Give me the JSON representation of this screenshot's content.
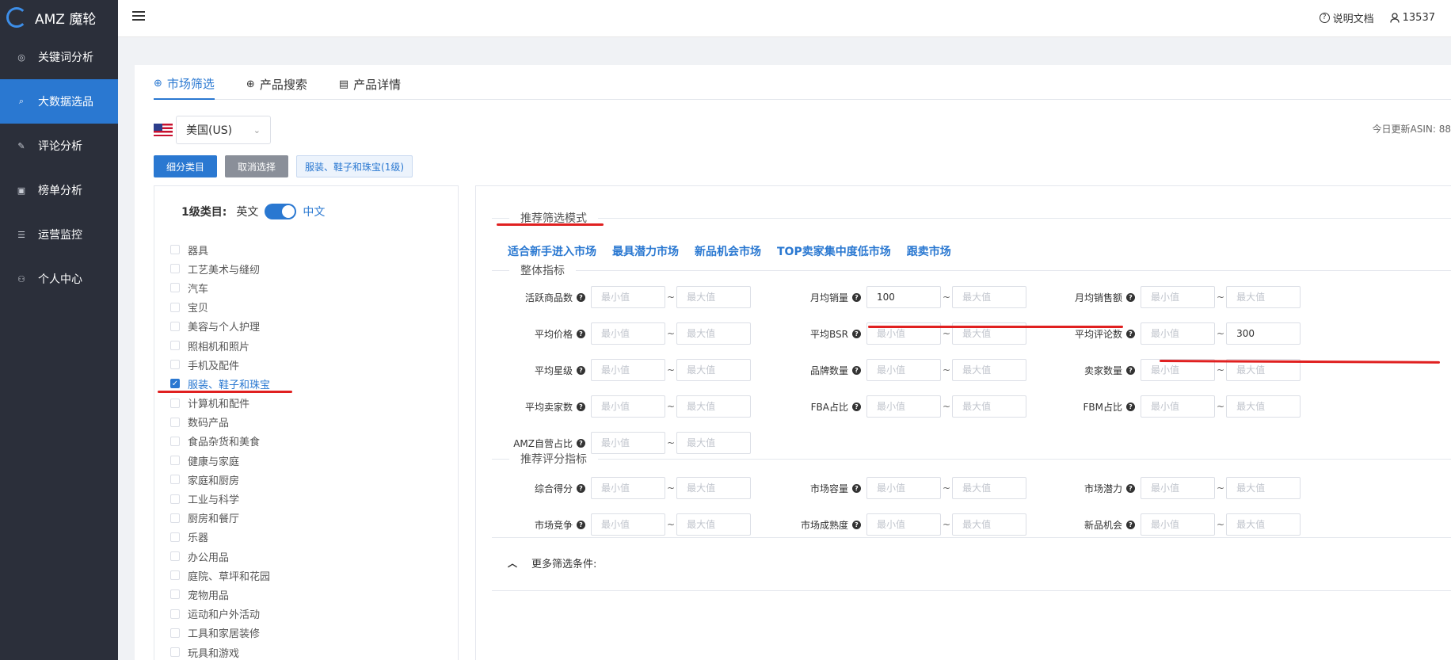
{
  "app": {
    "name": "AMZ 魔轮"
  },
  "sidebar": {
    "items": [
      {
        "label": "关键词分析",
        "icon": "target-icon"
      },
      {
        "label": "大数据选品",
        "icon": "search-icon",
        "active": true
      },
      {
        "label": "评论分析",
        "icon": "edit-icon"
      },
      {
        "label": "榜单分析",
        "icon": "calendar-icon"
      },
      {
        "label": "运营监控",
        "icon": "list-icon"
      },
      {
        "label": "个人中心",
        "icon": "users-icon"
      }
    ]
  },
  "topbar": {
    "help": "说明文档",
    "user": "13537"
  },
  "tabs": [
    {
      "label": "市场筛选",
      "icon": "crosshair-icon",
      "active": true
    },
    {
      "label": "产品搜索",
      "icon": "zoom-in-icon"
    },
    {
      "label": "产品详情",
      "icon": "document-icon"
    }
  ],
  "country": {
    "value": "美国(US)"
  },
  "update_text": "今日更新ASIN: 88",
  "buttons": {
    "subcategory": "细分类目",
    "cancel": "取消选择",
    "selected_tag": "服装、鞋子和珠宝(1级)"
  },
  "category_panel": {
    "title": "1级类目:",
    "lang_en": "英文",
    "lang_zh": "中文",
    "items": [
      {
        "label": "器具",
        "checked": false
      },
      {
        "label": "工艺美术与缝纫",
        "checked": false
      },
      {
        "label": "汽车",
        "checked": false
      },
      {
        "label": "宝贝",
        "checked": false
      },
      {
        "label": "美容与个人护理",
        "checked": false
      },
      {
        "label": "照相机和照片",
        "checked": false
      },
      {
        "label": "手机及配件",
        "checked": false
      },
      {
        "label": "服装、鞋子和珠宝",
        "checked": true
      },
      {
        "label": "计算机和配件",
        "checked": false
      },
      {
        "label": "数码产品",
        "checked": false
      },
      {
        "label": "食品杂货和美食",
        "checked": false
      },
      {
        "label": "健康与家庭",
        "checked": false
      },
      {
        "label": "家庭和厨房",
        "checked": false
      },
      {
        "label": "工业与科学",
        "checked": false
      },
      {
        "label": "厨房和餐厅",
        "checked": false
      },
      {
        "label": "乐器",
        "checked": false
      },
      {
        "label": "办公用品",
        "checked": false
      },
      {
        "label": "庭院、草坪和花园",
        "checked": false
      },
      {
        "label": "宠物用品",
        "checked": false
      },
      {
        "label": "运动和户外活动",
        "checked": false
      },
      {
        "label": "工具和家居装修",
        "checked": false
      },
      {
        "label": "玩具和游戏",
        "checked": false
      }
    ]
  },
  "filters": {
    "recommend_title": "推荐筛选模式",
    "modes": [
      "适合新手进入市场",
      "最具潜力市场",
      "新品机会市场",
      "TOP卖家集中度低市场",
      "跟卖市场"
    ],
    "overall_title": "整体指标",
    "overall_rows": [
      [
        {
          "label": "活跃商品数",
          "min": "",
          "max": ""
        },
        {
          "label": "月均销量",
          "min": "100",
          "max": ""
        },
        {
          "label": "月均销售额",
          "min": "",
          "max": ""
        }
      ],
      [
        {
          "label": "平均价格",
          "min": "",
          "max": ""
        },
        {
          "label": "平均BSR",
          "min": "",
          "max": ""
        },
        {
          "label": "平均评论数",
          "min": "",
          "max": "300"
        }
      ],
      [
        {
          "label": "平均星级",
          "min": "",
          "max": ""
        },
        {
          "label": "品牌数量",
          "min": "",
          "max": ""
        },
        {
          "label": "卖家数量",
          "min": "",
          "max": ""
        }
      ],
      [
        {
          "label": "平均卖家数",
          "min": "",
          "max": ""
        },
        {
          "label": "FBA占比",
          "min": "",
          "max": ""
        },
        {
          "label": "FBM占比",
          "min": "",
          "max": ""
        }
      ],
      [
        {
          "label": "AMZ自营占比",
          "min": "",
          "max": ""
        }
      ]
    ],
    "score_title": "推荐评分指标",
    "score_rows": [
      [
        {
          "label": "综合得分",
          "min": "",
          "max": ""
        },
        {
          "label": "市场容量",
          "min": "",
          "max": ""
        },
        {
          "label": "市场潜力",
          "min": "",
          "max": ""
        }
      ],
      [
        {
          "label": "市场竞争",
          "min": "",
          "max": ""
        },
        {
          "label": "市场成熟度",
          "min": "",
          "max": ""
        },
        {
          "label": "新品机会",
          "min": "",
          "max": ""
        }
      ]
    ],
    "placeholder_min": "最小值",
    "placeholder_max": "最大值",
    "tilde": "~",
    "help_glyph": "?",
    "more": "更多筛选条件:"
  },
  "colors": {
    "sidebar": "#2b2f3a",
    "accent": "#2a78d1",
    "annotation": "#e02020"
  }
}
